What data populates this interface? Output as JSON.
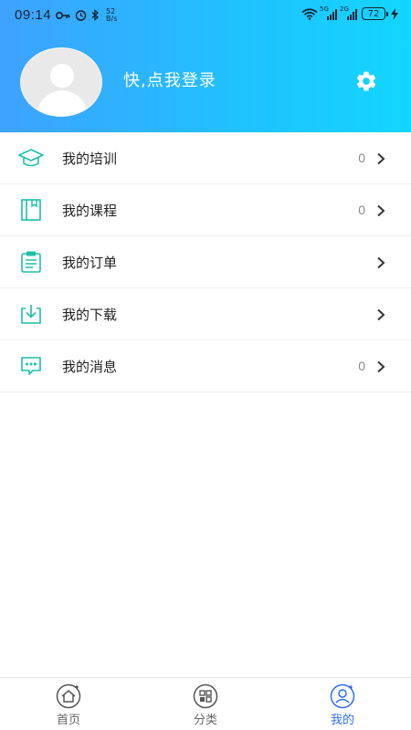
{
  "status_bar": {
    "time": "09:14",
    "net_speed_value": "52",
    "net_speed_unit": "B/s",
    "sim1_label": "5G",
    "sim2_label": "2G",
    "battery": "72"
  },
  "profile": {
    "login_prompt": "快,点我登录"
  },
  "menu": {
    "items": [
      {
        "label": "我的培训",
        "count": "0",
        "icon": "graduation-cap-icon"
      },
      {
        "label": "我的课程",
        "count": "0",
        "icon": "book-icon"
      },
      {
        "label": "我的订单",
        "count": "",
        "icon": "clipboard-icon"
      },
      {
        "label": "我的下载",
        "count": "",
        "icon": "download-icon"
      },
      {
        "label": "我的消息",
        "count": "0",
        "icon": "message-icon"
      }
    ]
  },
  "tabbar": {
    "tabs": [
      {
        "label": "首页",
        "icon": "home-icon",
        "active": false
      },
      {
        "label": "分类",
        "icon": "category-icon",
        "active": false
      },
      {
        "label": "我的",
        "icon": "profile-icon",
        "active": true
      }
    ]
  },
  "colors": {
    "header_gradient_start": "#3ea2ff",
    "header_gradient_end": "#12d6ff",
    "icon_teal": "#1bbfa6",
    "active_tab": "#2b6ff2"
  }
}
